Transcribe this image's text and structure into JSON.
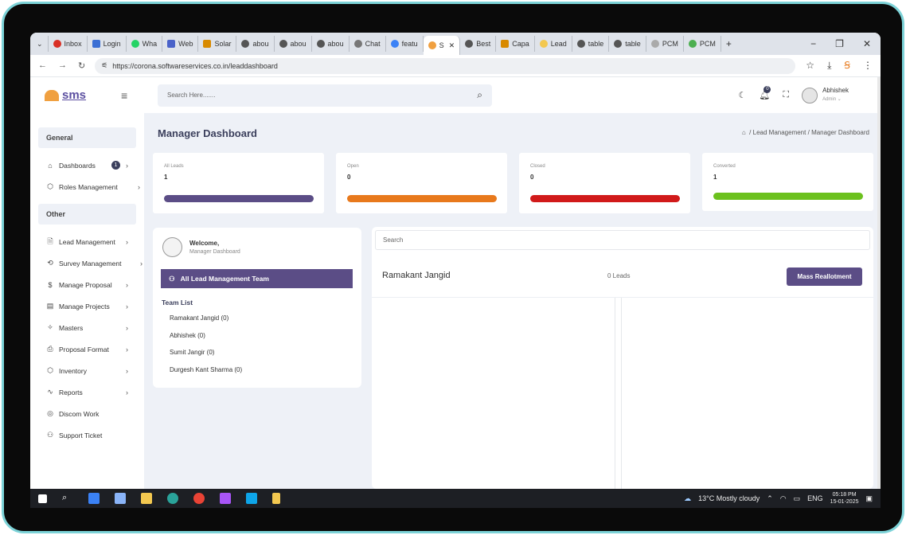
{
  "browser": {
    "tabs": [
      "Inbox",
      "Login",
      "Wha",
      "Web",
      "Solar",
      "abou",
      "abou",
      "abou",
      "Chat",
      "featu",
      "S",
      "Best",
      "Capa",
      "Lead",
      "table",
      "table",
      "PCM",
      "PCM"
    ],
    "url": "https://corona.softwareservices.co.in/leaddashboard",
    "new_tab": "+"
  },
  "app": {
    "logo_text": "sms",
    "search_placeholder": "Search Here.......",
    "user_name": "Abhishek",
    "user_role": "Admin",
    "notif_count": "0"
  },
  "sidebar": {
    "general_label": "General",
    "other_label": "Other",
    "general_items": [
      {
        "label": "Dashboards",
        "icon": "home-icon",
        "badge": "1"
      },
      {
        "label": "Roles Management",
        "icon": "cube-icon"
      }
    ],
    "other_items": [
      {
        "label": "Lead Management",
        "icon": "file-icon"
      },
      {
        "label": "Survey Management",
        "icon": "refresh-icon"
      },
      {
        "label": "Manage Proposal",
        "icon": "dollar-icon"
      },
      {
        "label": "Manage Projects",
        "icon": "server-icon"
      },
      {
        "label": "Masters",
        "icon": "tool-icon"
      },
      {
        "label": "Proposal Format",
        "icon": "printer-icon"
      },
      {
        "label": "Inventory",
        "icon": "box-icon"
      },
      {
        "label": "Reports",
        "icon": "activity-icon"
      },
      {
        "label": "Discom Work",
        "icon": "aperture-icon"
      },
      {
        "label": "Support Ticket",
        "icon": "users-icon"
      }
    ]
  },
  "page": {
    "title": "Manager Dashboard",
    "breadcrumb_1": "Lead Management",
    "breadcrumb_2": "Manager Dashboard",
    "sep": "/"
  },
  "stats": [
    {
      "label": "All Leads",
      "value": "1",
      "color": "#5b4d86"
    },
    {
      "label": "Open",
      "value": "0",
      "color": "#e8791c"
    },
    {
      "label": "Closed",
      "value": "0",
      "color": "#d11a1a"
    },
    {
      "label": "Converted",
      "value": "1",
      "color": "#6cc11e"
    }
  ],
  "welcome": {
    "title": "Welcome,",
    "subtitle": "Manager Dashboard",
    "team_button": "All Lead Management Team",
    "team_list_title": "Team List",
    "team": [
      "Ramakant Jangid (0)",
      "Abhishek (0)",
      "Sumit Jangir (0)",
      "Durgesh Kant Sharma (0)"
    ]
  },
  "right_panel": {
    "search_placeholder": "Search",
    "member_name": "Ramakant Jangid",
    "leads_count": "0 Leads",
    "mass_button": "Mass Reallotment"
  },
  "taskbar": {
    "weather": "13°C  Mostly cloudy",
    "lang": "ENG",
    "time": "05:18 PM",
    "date": "15-01-2025"
  }
}
